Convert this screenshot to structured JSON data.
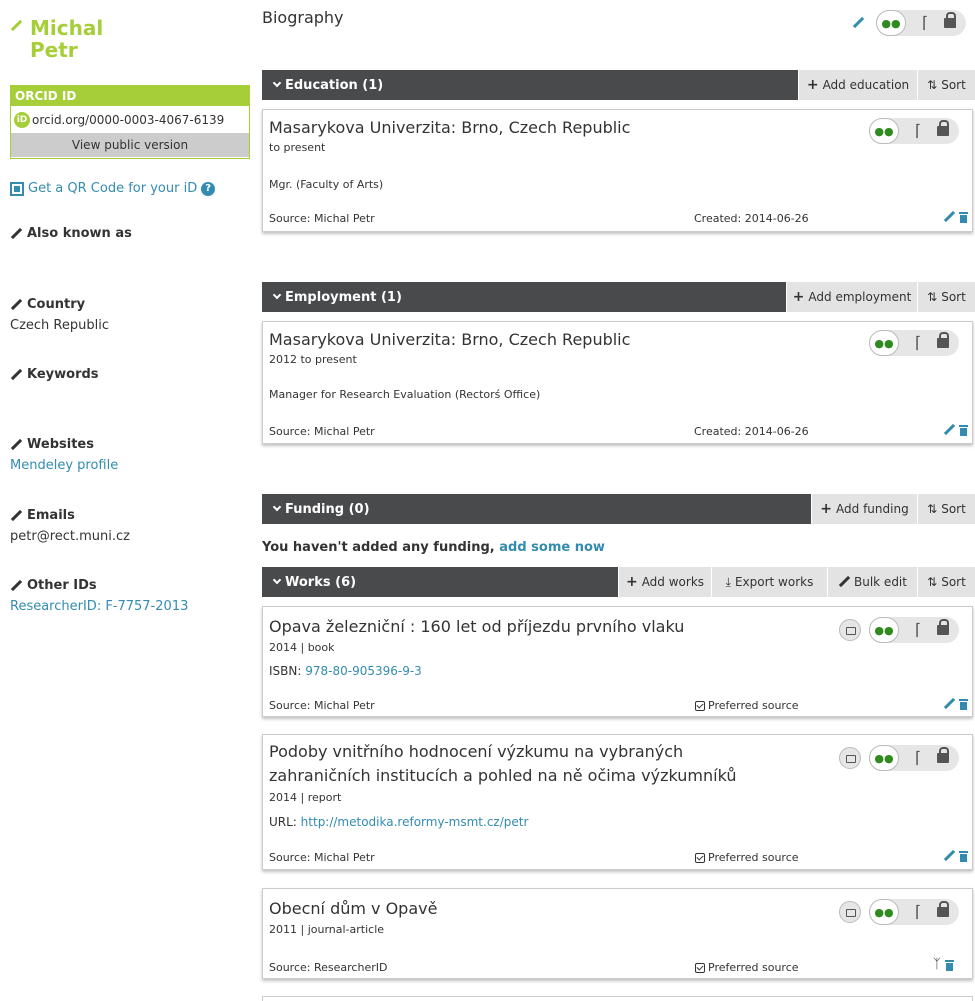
{
  "profile": {
    "first_name": "Michal",
    "last_name": "Petr",
    "orcid_label": "ORCID ID",
    "orcid_id": "orcid.org/0000-0003-4067-6139",
    "id_badge": "iD",
    "view_public": "View public version",
    "qr_link": "Get a QR Code for your iD",
    "also_known_as": "Also known as",
    "country_label": "Country",
    "country_value": "Czech Republic",
    "keywords_label": "Keywords",
    "websites_label": "Websites",
    "website_value": "Mendeley profile",
    "emails_label": "Emails",
    "email_value": "petr@rect.muni.cz",
    "other_ids_label": "Other IDs",
    "other_ids_value": "ResearcherID: F-7757-2013"
  },
  "main": {
    "biography_title": "Biography",
    "education": {
      "title": "Education (1)",
      "add_label": "Add education",
      "sort_label": "Sort",
      "items": [
        {
          "title": "Masarykova Univerzita: Brno, Czech Republic",
          "dates": "to present",
          "role": "Mgr. (Faculty of Arts)",
          "source": "Source: Michal Petr",
          "created": "Created: 2014-06-26"
        }
      ]
    },
    "employment": {
      "title": "Employment (1)",
      "add_label": "Add employment",
      "sort_label": "Sort",
      "items": [
        {
          "title": "Masarykova Univerzita: Brno, Czech Republic",
          "dates": "2012 to present",
          "role": "Manager for Research Evaluation (Rectorś Office)",
          "source": "Source: Michal Petr",
          "created": "Created: 2014-06-26"
        }
      ]
    },
    "funding": {
      "title": "Funding (0)",
      "add_label": "Add funding",
      "sort_label": "Sort",
      "empty_text": "You haven't added any funding, ",
      "empty_link": "add some now"
    },
    "works": {
      "title": "Works (6)",
      "add_label": "Add works",
      "export_label": "Export works",
      "bulk_label": "Bulk edit",
      "sort_label": "Sort",
      "items": [
        {
          "title_line1": "Opava železniční : 160 let od příjezdu prvního vlaku",
          "meta": "2014 | book",
          "id_label": "ISBN: ",
          "id_value": "978-80-905396-9-3",
          "source": "Source: Michal Petr",
          "preferred": "Preferred source"
        },
        {
          "title_line1": "Podoby vnitřního hodnocení výzkumu na vybraných",
          "title_line2": "zahraničních institucích a pohled na ně očima výzkumníků",
          "meta": "2014 | report",
          "id_label": "URL: ",
          "id_value": "http://metodika.reformy-msmt.cz/petr",
          "source": "Source: Michal Petr",
          "preferred": "Preferred source"
        },
        {
          "title_line1": "Obecní dům v Opavě",
          "meta": "2011 | journal-article",
          "source": "Source: ResearcherID",
          "preferred": "Preferred source"
        }
      ]
    }
  },
  "icons": {
    "everyone": "group-icon",
    "limited": "key-icon",
    "private": "lock-icon"
  },
  "colors": {
    "orcid_green": "#a6ce39",
    "link_blue": "#338caf",
    "bar_dark": "#494a4c",
    "everyone_green": "#2e8b1e"
  }
}
